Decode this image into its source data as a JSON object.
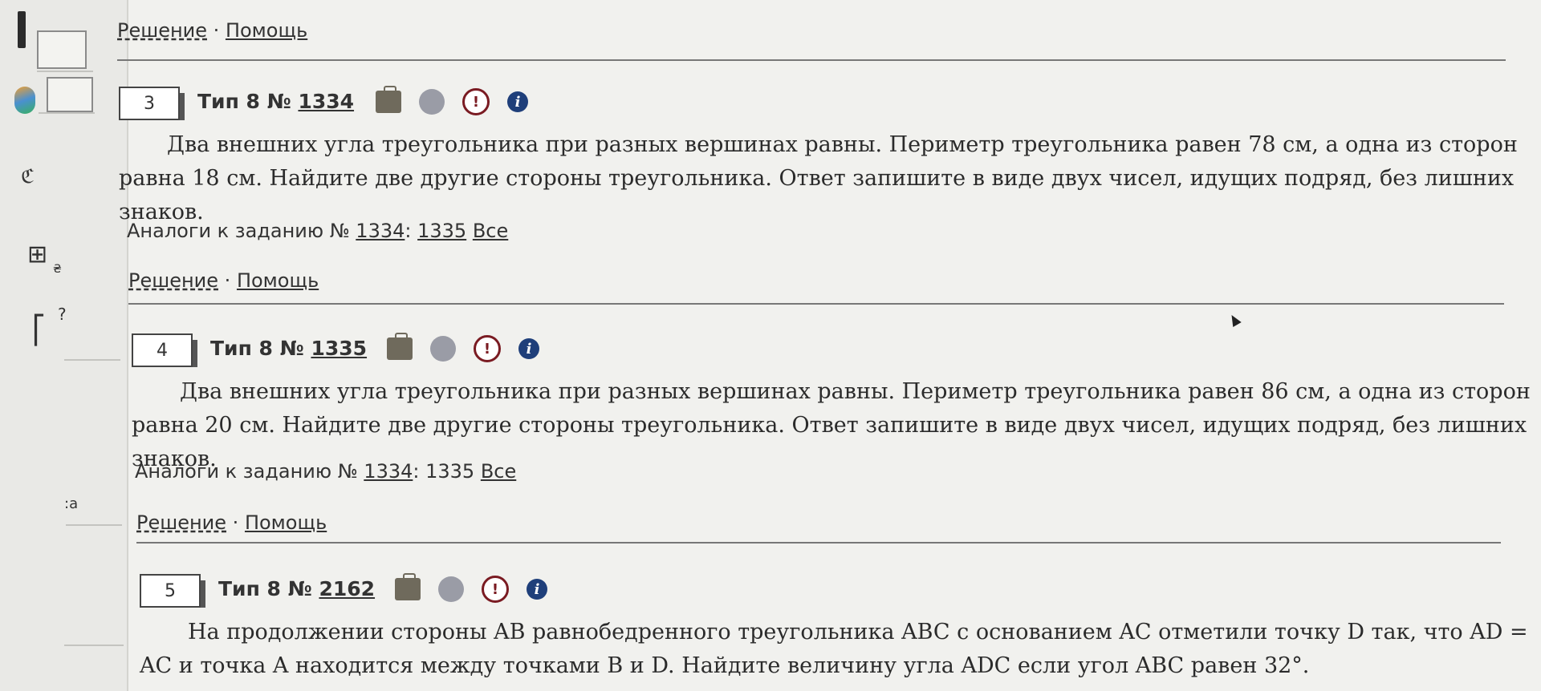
{
  "solution_links": {
    "solution": "Решение",
    "separator": "·",
    "help": "Помощь"
  },
  "sidebar": {
    "glyphs": {
      "infinity": "ℭ",
      "calc": "⊞",
      "arrow": "₴",
      "question": "?",
      "bracket": "⎡",
      "colon_a": ":a"
    }
  },
  "tasks": [
    {
      "number": "3",
      "type_prefix": "Тип 8 №",
      "id": "1334",
      "text": "Два внешних угла треугольника при разных вершинах равны. Периметр треугольника равен 78 см, а одна из сторон равна 18 см. Найдите две другие стороны треугольника. Ответ запишите в виде двух чисел, идущих подряд, без лишних знаков.",
      "analogs_label": "Аналоги к заданию №",
      "analog_ids": [
        "1334",
        "1335"
      ],
      "analog_all": "Все"
    },
    {
      "number": "4",
      "type_prefix": "Тип 8 №",
      "id": "1335",
      "text": "Два внешних угла треугольника при разных вершинах равны. Периметр треугольника равен 86 см, а одна из сторон равна 20 см. Найдите две другие стороны треугольника. Ответ запишите в виде двух чисел, идущих подряд, без лишних знаков.",
      "analogs_label": "Аналоги к заданию №",
      "analog_ids": [
        "1334",
        "1335"
      ],
      "analog_all": "Все"
    },
    {
      "number": "5",
      "type_prefix": "Тип 8 №",
      "id": "2162",
      "text": "На продолжении стороны AB равнобедренного треугольника ABC с основанием AC отметили точку D так, что AD = AC и точка A находится между точками B и D. Найдите величину угла ADC если угол ABC равен 32°."
    }
  ],
  "icons": {
    "excl": "!",
    "info": "i",
    "colon": ":"
  },
  "colors": {
    "excl": "#7a1b22",
    "info": "#1f3f7a"
  }
}
